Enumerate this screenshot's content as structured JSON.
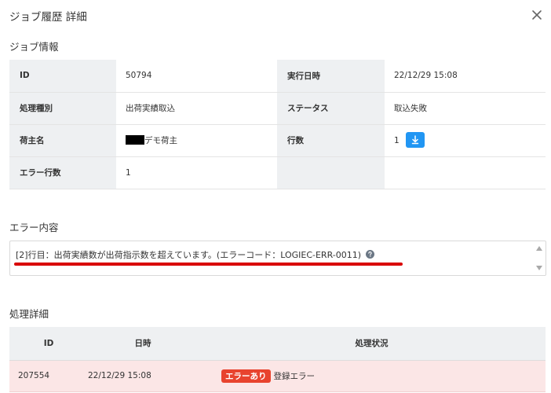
{
  "dialog": {
    "title": "ジョブ履歴 詳細"
  },
  "job_info": {
    "title": "ジョブ情報",
    "rows": [
      {
        "l1": "ID",
        "v1": "50794",
        "l2": "実行日時",
        "v2": "22/12/29 15:08"
      },
      {
        "l1": "処理種別",
        "v1": "出荷実績取込",
        "l2": "ステータス",
        "v2": "取込失敗"
      },
      {
        "l1": "荷主名",
        "v1": "デモ荷主",
        "l2": "行数",
        "v2": "1"
      },
      {
        "l1": "エラー行数",
        "v1": "1",
        "l2": "",
        "v2": ""
      }
    ]
  },
  "error_content": {
    "title": "エラー内容",
    "text": "[2]行目：出荷実績数が出荷指示数を超えています。(エラーコード：LOGIEC-ERR-0011)"
  },
  "process_detail": {
    "title": "処理詳細",
    "headers": {
      "id": "ID",
      "date": "日時",
      "status": "処理状況"
    },
    "rows": [
      {
        "id": "207554",
        "date": "22/12/29 15:08",
        "badge": "エラーあり",
        "status": "登録エラー"
      }
    ]
  },
  "colors": {
    "accent": "#2196f3",
    "error": "#e8432e",
    "error_row": "#fbe6e6",
    "label_bg": "#eef0f2"
  },
  "icons": {
    "close": "close-icon",
    "download": "download-icon",
    "help": "help-icon"
  }
}
